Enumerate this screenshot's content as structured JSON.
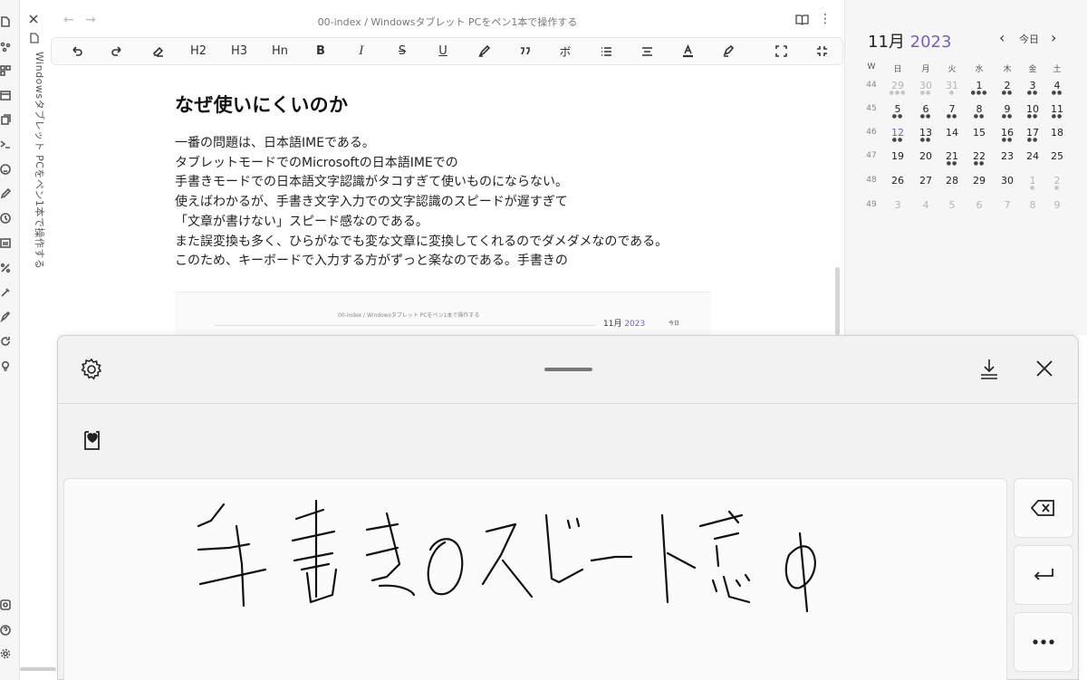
{
  "editor": {
    "breadcrumb": "00-index / Windowsタブレット PCをペン1本で操作する",
    "vertical_title": "Windowsタブレット PCをペン1本で操作する",
    "heading": "なぜ使いにくいのか",
    "paragraphs": [
      "一番の問題は、日本語IMEである。",
      "タブレットモードでのMicrosoftの日本語IMEでの",
      "手書きモードでの日本語文字認識がタコすぎて使いものにならない。",
      "使えばわかるが、手書き文字入力での文字認識のスピードが遅すぎて",
      "「文章が書けない」スピード感なのである。",
      "また誤変換も多く、ひらがなでも変な文章に変換してくれるのでダメダメなのである。",
      "このため、キーボードで入力する方がずっと楽なのである。手書きの"
    ]
  },
  "toolbar": {
    "h2": "H2",
    "h3": "H3",
    "hn": "Hn",
    "bold": "B",
    "italic": "I",
    "strike": "S",
    "underline": "U",
    "ruby": "ボ"
  },
  "thumbnail": {
    "breadcrumb": "00-index / Windowsタブレット PCをペン1本で操作する",
    "month": "11月",
    "year": "2023",
    "today": "今日"
  },
  "calendar": {
    "month": "11月",
    "year": "2023",
    "today_label": "今日",
    "headers": [
      "W",
      "日",
      "月",
      "火",
      "水",
      "木",
      "金",
      "土"
    ],
    "weeks": [
      {
        "w": "44",
        "days": [
          "29",
          "30",
          "31",
          "1",
          "2",
          "3",
          "4"
        ],
        "dots": [
          "●●●",
          "●●",
          "●",
          "●●●",
          "●●",
          "●●",
          "●●"
        ],
        "muted": [
          true,
          true,
          true,
          false,
          false,
          false,
          false
        ]
      },
      {
        "w": "45",
        "days": [
          "5",
          "6",
          "7",
          "8",
          "9",
          "10",
          "11"
        ],
        "dots": [
          "●●",
          "●●",
          "●●",
          "●●",
          "●●",
          "●●",
          "●●"
        ],
        "muted": [
          false,
          false,
          false,
          false,
          false,
          false,
          false
        ]
      },
      {
        "w": "46",
        "days": [
          "12",
          "13",
          "14",
          "15",
          "16",
          "17",
          "18"
        ],
        "dots": [
          "●●",
          "●●",
          "",
          "",
          "●●",
          "●●",
          ""
        ],
        "muted": [
          false,
          false,
          false,
          false,
          false,
          false,
          false
        ]
      },
      {
        "w": "47",
        "days": [
          "19",
          "20",
          "21",
          "22",
          "23",
          "24",
          "25"
        ],
        "dots": [
          "",
          "",
          "●●",
          "●●",
          "",
          "",
          ""
        ],
        "muted": [
          false,
          false,
          false,
          false,
          false,
          false,
          false
        ]
      },
      {
        "w": "48",
        "days": [
          "26",
          "27",
          "28",
          "29",
          "30",
          "1",
          "2"
        ],
        "dots": [
          "",
          "",
          "",
          "",
          "",
          "●",
          "●"
        ],
        "muted": [
          false,
          false,
          false,
          false,
          false,
          true,
          true
        ]
      },
      {
        "w": "49",
        "days": [
          "3",
          "4",
          "5",
          "6",
          "7",
          "8",
          "9"
        ],
        "dots": [
          "",
          "",
          "",
          "",
          "",
          "",
          ""
        ],
        "muted": [
          true,
          true,
          true,
          true,
          true,
          true,
          true
        ]
      }
    ],
    "today_day": "12"
  },
  "handwriting": {
    "handwritten_text": "手書きのスピード感φ"
  }
}
